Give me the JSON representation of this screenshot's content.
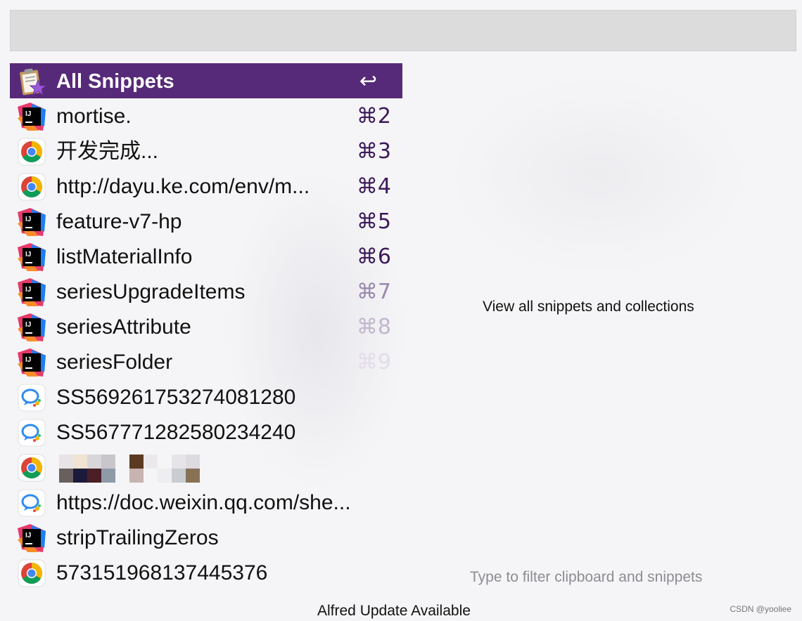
{
  "icons": {
    "clipboard": "clipboard-snippets-icon",
    "intellij": "intellij-idea-icon",
    "chrome": "chrome-icon",
    "chat": "wechat-work-icon"
  },
  "colors": {
    "selection": "#572a79",
    "shortcut": "#3d1a5a",
    "search_bg": "#dcdcdc"
  },
  "results": [
    {
      "label": "All Snippets",
      "shortcut": "↩",
      "icon": "clipboard-snippets-icon",
      "selected": true
    },
    {
      "label": "mortise.",
      "shortcut": "⌘2",
      "icon": "intellij-idea-icon"
    },
    {
      "label": "开发完成...",
      "shortcut": "⌘3",
      "icon": "chrome-icon"
    },
    {
      "label": "http://dayu.ke.com/env/m...",
      "shortcut": "⌘4",
      "icon": "chrome-icon"
    },
    {
      "label": "feature-v7-hp",
      "shortcut": "⌘5",
      "icon": "intellij-idea-icon"
    },
    {
      "label": "listMaterialInfo",
      "shortcut": "⌘6",
      "icon": "intellij-idea-icon"
    },
    {
      "label": "seriesUpgradeItems",
      "shortcut": "⌘7",
      "icon": "intellij-idea-icon"
    },
    {
      "label": "seriesAttribute",
      "shortcut": "⌘8",
      "icon": "intellij-idea-icon"
    },
    {
      "label": "seriesFolder",
      "shortcut": "⌘9",
      "icon": "intellij-idea-icon"
    },
    {
      "label": "SS569261753274081280",
      "shortcut": "",
      "icon": "wechat-work-icon"
    },
    {
      "label": "SS567771282580234240",
      "shortcut": "",
      "icon": "wechat-work-icon"
    },
    {
      "label": "",
      "shortcut": "",
      "icon": "chrome-icon",
      "redacted": true
    },
    {
      "label": "https://doc.weixin.qq.com/she...",
      "shortcut": "",
      "icon": "wechat-work-icon"
    },
    {
      "label": "stripTrailingZeros",
      "shortcut": "",
      "icon": "intellij-idea-icon"
    },
    {
      "label": "573151968137445376",
      "shortcut": "",
      "icon": "chrome-icon"
    }
  ],
  "preview": {
    "text": "View all snippets and collections"
  },
  "filter_hint": "Type to filter clipboard and snippets",
  "footer": {
    "update": "Alfred Update Available"
  },
  "watermark": "CSDN @yooliee"
}
